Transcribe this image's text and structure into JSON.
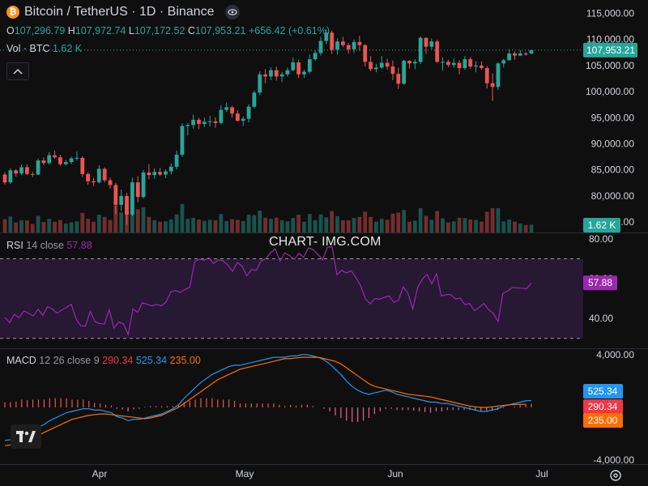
{
  "header": {
    "symbol_title": "Bitcoin / TetherUS · 1D · Binance",
    "symbol_icon": "bitcoin-icon",
    "visibility_icon": "eye-icon",
    "ohlc": {
      "o_label": "O",
      "o_value": "107,296.79",
      "h_label": "H",
      "h_value": "107,972.74",
      "l_label": "L",
      "l_value": "107,172.52",
      "c_label": "C",
      "c_value": "107,953.21",
      "change": "+656.42 (+0.61%)"
    },
    "volume_label": "Vol · BTC",
    "volume_value": "1.62 K"
  },
  "rsi_header": {
    "label": "RSI",
    "params": "14 close",
    "value": "57.88"
  },
  "macd_header": {
    "label": "MACD",
    "params": "12 26 close 9",
    "macd_value": "290.34",
    "signal_value": "525.34",
    "hist_value": "235.00"
  },
  "watermark": "CHART- IMG.COM",
  "colors": {
    "up": "#26a69a",
    "down": "#ef5350",
    "background": "#0f0f0f",
    "rsi_line": "#9c27b0",
    "macd_line": "#2196f3",
    "signal_line": "#ff6d00",
    "hist_up": "#ef5350",
    "hist_down": "#f06292"
  },
  "chart_data": [
    {
      "type": "candlestick",
      "title": "Bitcoin / TetherUS · 1D · Binance",
      "x_ticks": [
        "Apr",
        "May",
        "Jun",
        "Jul"
      ],
      "y_ticks": [
        "75,000.00",
        "80,000.00",
        "85,000.00",
        "90,000.00",
        "95,000.00",
        "100,000.00",
        "105,000.00",
        "110,000.00",
        "115,000.00"
      ],
      "ylim": [
        73000,
        116000
      ],
      "last_price_label": "107,953.21",
      "ohlc": [
        [
          84100,
          84500,
          82200,
          82600
        ],
        [
          82600,
          85300,
          82300,
          84900
        ],
        [
          84900,
          85100,
          83700,
          84300
        ],
        [
          84300,
          86000,
          84000,
          85500
        ],
        [
          85500,
          86000,
          84000,
          84200
        ],
        [
          84200,
          84600,
          83600,
          84100
        ],
        [
          84100,
          87200,
          84000,
          86800
        ],
        [
          86800,
          87400,
          85900,
          86300
        ],
        [
          86300,
          88400,
          86000,
          87800
        ],
        [
          87800,
          88700,
          87100,
          87400
        ],
        [
          87400,
          87900,
          85800,
          86100
        ],
        [
          86100,
          86900,
          85800,
          86500
        ],
        [
          86500,
          87500,
          86100,
          87200
        ],
        [
          87200,
          88500,
          86800,
          87300
        ],
        [
          87300,
          87600,
          83600,
          84200
        ],
        [
          84200,
          84500,
          82100,
          82800
        ],
        [
          82800,
          83500,
          81900,
          82600
        ],
        [
          82600,
          85900,
          82400,
          85200
        ],
        [
          85200,
          85500,
          82600,
          83000
        ],
        [
          83000,
          83500,
          81400,
          82100
        ],
        [
          82100,
          82500,
          76500,
          78300
        ],
        [
          78300,
          81200,
          77100,
          80000
        ],
        [
          80000,
          80600,
          74500,
          76400
        ],
        [
          76400,
          83500,
          76100,
          82600
        ],
        [
          82600,
          83800,
          78800,
          79800
        ],
        [
          79800,
          85000,
          79500,
          84500
        ],
        [
          84500,
          86100,
          83200,
          84000
        ],
        [
          84000,
          85300,
          83300,
          84600
        ],
        [
          84600,
          85400,
          83800,
          84100
        ],
        [
          84100,
          85100,
          83400,
          84700
        ],
        [
          84700,
          86300,
          84100,
          85600
        ],
        [
          85600,
          88700,
          85100,
          87900
        ],
        [
          87900,
          93900,
          87500,
          93400
        ],
        [
          93400,
          94000,
          91600,
          93600
        ],
        [
          93600,
          95600,
          92900,
          94600
        ],
        [
          94600,
          95000,
          92800,
          93800
        ],
        [
          93800,
          95000,
          93200,
          94200
        ],
        [
          94200,
          95400,
          93300,
          94300
        ],
        [
          94300,
          95100,
          93100,
          94000
        ],
        [
          94000,
          97400,
          93700,
          96500
        ],
        [
          96500,
          97900,
          96100,
          97000
        ],
        [
          97000,
          97300,
          95000,
          95800
        ],
        [
          95800,
          96400,
          94300,
          94400
        ],
        [
          94400,
          95200,
          93400,
          94800
        ],
        [
          94800,
          97600,
          94100,
          97100
        ],
        [
          97100,
          100200,
          96800,
          99800
        ],
        [
          99800,
          103900,
          99300,
          103300
        ],
        [
          103300,
          104300,
          101600,
          102900
        ],
        [
          102900,
          104600,
          102200,
          104100
        ],
        [
          104100,
          104800,
          102100,
          102900
        ],
        [
          102900,
          103800,
          101800,
          103300
        ],
        [
          103300,
          104600,
          102900,
          104100
        ],
        [
          104100,
          106500,
          103900,
          105600
        ],
        [
          105600,
          106100,
          102600,
          103300
        ],
        [
          103300,
          104200,
          102600,
          103800
        ],
        [
          103800,
          107100,
          103400,
          106200
        ],
        [
          106200,
          107900,
          105900,
          107400
        ],
        [
          107400,
          110500,
          106900,
          109700
        ],
        [
          109700,
          111900,
          109100,
          111300
        ],
        [
          111300,
          111700,
          107200,
          108000
        ],
        [
          108000,
          110200,
          107100,
          109600
        ],
        [
          109600,
          110500,
          108500,
          108900
        ],
        [
          108900,
          109300,
          107300,
          108100
        ],
        [
          108100,
          110000,
          107400,
          109500
        ],
        [
          109500,
          110700,
          107800,
          108900
        ],
        [
          108900,
          109100,
          104800,
          105700
        ],
        [
          105700,
          106800,
          103900,
          104300
        ],
        [
          104300,
          105300,
          103700,
          104600
        ],
        [
          104600,
          106800,
          104400,
          105500
        ],
        [
          105500,
          106300,
          104200,
          104800
        ],
        [
          104800,
          106000,
          102200,
          103400
        ],
        [
          103400,
          104600,
          100500,
          101500
        ],
        [
          101500,
          106100,
          101300,
          105900
        ],
        [
          105900,
          106000,
          104400,
          105400
        ],
        [
          105400,
          106200,
          104300,
          105700
        ],
        [
          105700,
          110600,
          105300,
          110300
        ],
        [
          110300,
          110400,
          107200,
          108600
        ],
        [
          108600,
          110200,
          108100,
          109600
        ],
        [
          109600,
          110000,
          105500,
          105700
        ],
        [
          105700,
          106500,
          104000,
          105700
        ],
        [
          105700,
          106100,
          104700,
          105100
        ],
        [
          105100,
          106300,
          104600,
          105500
        ],
        [
          105500,
          106000,
          103300,
          104500
        ],
        [
          104500,
          106800,
          104200,
          106200
        ],
        [
          106200,
          106600,
          104400,
          104800
        ],
        [
          104800,
          105800,
          103700,
          105000
        ],
        [
          105000,
          105800,
          104200,
          104500
        ],
        [
          104500,
          104900,
          100600,
          101600
        ],
        [
          101600,
          103500,
          98200,
          100900
        ],
        [
          100900,
          105600,
          100300,
          105400
        ],
        [
          105400,
          106300,
          104600,
          106000
        ],
        [
          106000,
          108200,
          106000,
          107300
        ],
        [
          107300,
          107700,
          106100,
          106900
        ],
        [
          106900,
          107900,
          106800,
          107300
        ],
        [
          107300,
          107600,
          106900,
          107100
        ],
        [
          107296.79,
          107972.74,
          107172.52,
          107953.21
        ]
      ],
      "volume_series_name": "Vol · BTC",
      "volume_last": "1.62 K"
    },
    {
      "type": "line",
      "title": "RSI 14 close",
      "y_ticks": [
        "40.00",
        "60.00",
        "80.00"
      ],
      "ylim": [
        25,
        82
      ],
      "bands": [
        30,
        70
      ],
      "last_label": "57.88",
      "values": [
        40.5,
        37.9,
        42.1,
        40.4,
        43.8,
        42.7,
        41.2,
        44.7,
        41.5,
        45.9,
        44.8,
        42.7,
        44.2,
        45.6,
        47.1,
        39.8,
        36.3,
        36.2,
        43.6,
        38.4,
        37.4,
        37.2,
        44.4,
        35.2,
        38.2,
        37.3,
        31.9,
        44.8,
        43.1,
        47.9,
        47.1,
        46.3,
        47.1,
        46.4,
        48.3,
        53.4,
        54.0,
        53.1,
        54.6,
        55.7,
        68.5,
        69.8,
        69.3,
        70.5,
        67.6,
        69.4,
        69.0,
        66.8,
        63.7,
        68.1,
        66.4,
        61.4,
        64.6,
        64.2,
        68.8,
        70.1,
        73.0,
        75.0,
        68.8,
        72.9,
        71.7,
        69.7,
        72.8,
        70.8,
        75.5,
        74.6,
        72.2,
        69.5,
        75.8,
        76.0,
        62.0,
        64.2,
        62.9,
        64.0,
        60.6,
        56.5,
        50.0,
        47.3,
        50.0,
        49.7,
        50.6,
        51.3,
        48.1,
        49.3,
        55.9,
        52.6,
        44.7,
        55.4,
        59.6,
        62.2,
        57.4,
        62.4,
        51.4,
        51.9,
        52.0,
        49.8,
        50.3,
        46.9,
        47.5,
        43.9,
        45.5,
        47.6,
        44.3,
        42.5,
        38.5,
        52.6,
        53.8,
        55.5,
        55.4,
        55.2,
        55.0,
        57.88
      ]
    },
    {
      "type": "line",
      "title": "MACD 12 26 close 9",
      "y_ticks": [
        "-4,000.00",
        "4,000.00"
      ],
      "ylim": [
        -4300,
        4300
      ],
      "series": [
        {
          "name": "MACD",
          "values": [
            -2500,
            -2450,
            -2300,
            -2000,
            -1900,
            -1700,
            -1500,
            -1300,
            -1000,
            -800,
            -600,
            -400,
            -300,
            -200,
            -100,
            -100,
            -200,
            -200,
            -300,
            -400,
            -700,
            -800,
            -1000,
            -900,
            -900,
            -800,
            -700,
            -600,
            -500,
            -300,
            -100,
            200,
            700,
            1100,
            1500,
            1900,
            2200,
            2500,
            2700,
            2900,
            3100,
            3200,
            3200,
            3300,
            3400,
            3500,
            3600,
            3700,
            3800,
            3800,
            3800,
            3900,
            3900,
            4000,
            4000,
            3900,
            3800,
            3600,
            3300,
            2900,
            2500,
            2000,
            1600,
            1300,
            1100,
            1000,
            1100,
            1200,
            1300,
            1200,
            1000,
            900,
            800,
            700,
            600,
            500,
            400,
            400,
            300,
            300,
            200,
            100,
            0,
            -100,
            -200,
            -300,
            -300,
            -200,
            -100,
            100,
            200,
            300,
            400,
            500,
            525.34
          ]
        },
        {
          "name": "Signal",
          "values": [
            -2900,
            -2850,
            -2750,
            -2600,
            -2450,
            -2300,
            -2100,
            -1900,
            -1700,
            -1500,
            -1300,
            -1100,
            -900,
            -800,
            -700,
            -600,
            -550,
            -500,
            -500,
            -550,
            -600,
            -650,
            -700,
            -750,
            -800,
            -850,
            -800,
            -700,
            -600,
            -400,
            -200,
            0,
            300,
            600,
            900,
            1200,
            1500,
            1800,
            2100,
            2300,
            2500,
            2700,
            2900,
            3000,
            3100,
            3200,
            3300,
            3400,
            3500,
            3600,
            3700,
            3700,
            3750,
            3800,
            3800,
            3800,
            3800,
            3700,
            3600,
            3500,
            3300,
            3000,
            2700,
            2400,
            2100,
            1800,
            1600,
            1500,
            1400,
            1300,
            1200,
            1100,
            1000,
            950,
            900,
            850,
            800,
            700,
            600,
            500,
            400,
            300,
            200,
            100,
            50,
            0,
            0,
            50,
            100,
            150,
            200,
            220,
            230,
            235
          ]
        },
        {
          "name": "Histogram",
          "values": [
            400,
            400,
            450,
            600,
            550,
            600,
            600,
            600,
            700,
            700,
            700,
            700,
            600,
            600,
            600,
            500,
            350,
            300,
            200,
            150,
            -100,
            -150,
            -300,
            -150,
            -100,
            50,
            100,
            100,
            100,
            100,
            100,
            200,
            400,
            500,
            600,
            700,
            700,
            700,
            600,
            600,
            600,
            500,
            300,
            300,
            300,
            300,
            300,
            300,
            300,
            200,
            100,
            200,
            150,
            200,
            200,
            100,
            0,
            -100,
            -300,
            -600,
            -800,
            -1000,
            -1100,
            -1100,
            -1000,
            -800,
            -500,
            -300,
            -100,
            -100,
            -200,
            -200,
            -200,
            -250,
            -300,
            -350,
            -400,
            -300,
            -300,
            -200,
            -200,
            -200,
            -200,
            -200,
            -250,
            -300,
            -300,
            -250,
            -200,
            -50,
            0,
            80,
            170,
            265,
            290.34
          ]
        }
      ]
    }
  ]
}
